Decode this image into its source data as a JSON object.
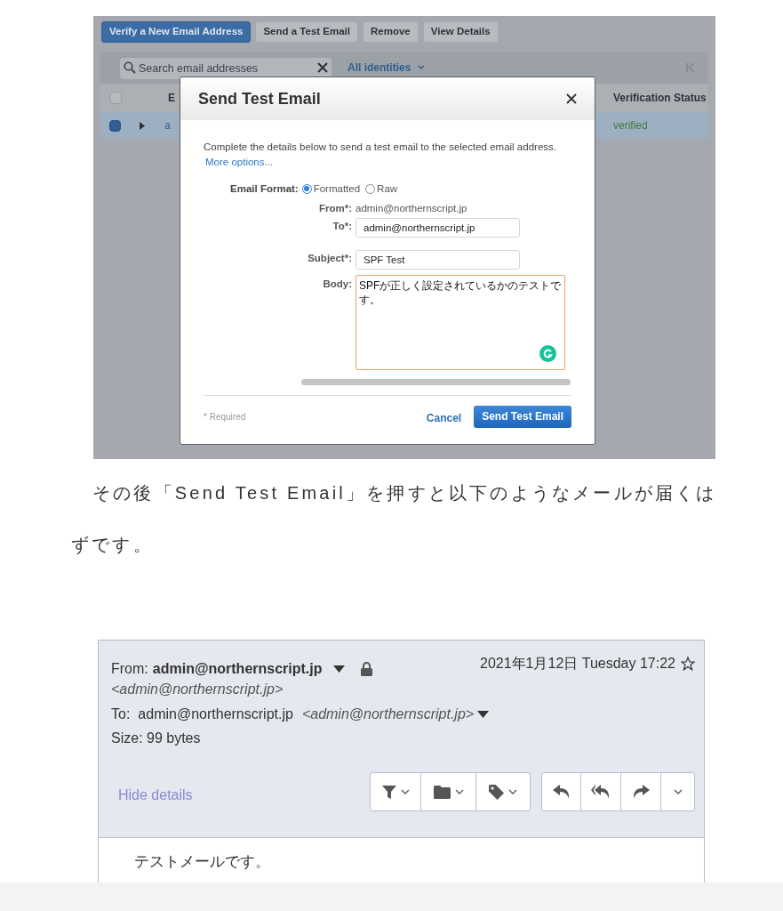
{
  "console": {
    "toolbar_buttons": [
      {
        "label": "Verify a New Email Address",
        "kind": "primary"
      },
      {
        "label": "Send a Test Email",
        "kind": "default"
      },
      {
        "label": "Remove",
        "kind": "default"
      },
      {
        "label": "View Details",
        "kind": "default"
      }
    ],
    "search": {
      "placeholder": "Search email addresses"
    },
    "filter": "All identities",
    "select_all": {
      "checked": false
    },
    "columns": [
      "E",
      "Verification Status"
    ],
    "rows": [
      {
        "selected": true,
        "cells": [
          "a"
        ],
        "status": "verified"
      }
    ]
  },
  "dialog": {
    "title": "Send Test Email",
    "intro": "Complete the details below to send a test email to the selected email address.",
    "more_options": "More options...",
    "format_label": "Email Format:",
    "format_options": [
      {
        "label": "Formatted",
        "selected": true
      },
      {
        "label": "Raw",
        "selected": false
      }
    ],
    "from_label": "From*:",
    "from_value": "admin@northernscript.jp",
    "to_label": "To*:",
    "to_value": "admin@northernscript.jp",
    "subject_label": "Subject*:",
    "subject_value": "SPF Test",
    "body_label": "Body:",
    "body_value": "SPFが正しく設定されているかのテストです。",
    "required_note": "* Required",
    "cancel": "Cancel",
    "submit": "Send Test Email"
  },
  "paragraph": "その後「Send Test Email」を押すと以下のようなメールが届くはずです。",
  "mail": {
    "from_label": "From:",
    "from_name": "admin@northernscript.jp",
    "from_address": "<admin@northernscript.jp>",
    "date": "2021年1月12日 Tuesday 17:22",
    "to_label": "To:",
    "to_name": "admin@northernscript.jp",
    "to_address": "<admin@northernscript.jp>",
    "size": "Size: 99 bytes",
    "hide_details": "Hide details",
    "body": "テストメールです。"
  }
}
